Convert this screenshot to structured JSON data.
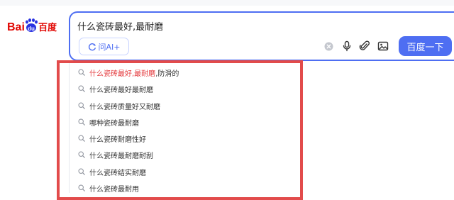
{
  "logo": {
    "text_left": "Bai",
    "text_paw": "du",
    "text_right": "百度"
  },
  "search": {
    "query": "什么瓷砖最好,最耐磨",
    "ai_button_label": "问AI+",
    "submit_label": "百度一下"
  },
  "suggestions": [
    {
      "highlight": "什么瓷砖最好,最耐磨",
      "rest": ",防滑的"
    },
    {
      "highlight": "",
      "rest": "什么瓷砖最好最耐磨"
    },
    {
      "highlight": "",
      "rest": "什么瓷砖质量好又耐磨"
    },
    {
      "highlight": "",
      "rest": "哪种瓷砖最耐磨"
    },
    {
      "highlight": "",
      "rest": "什么瓷砖耐磨性好"
    },
    {
      "highlight": "",
      "rest": "什么瓷砖最耐磨耐刮"
    },
    {
      "highlight": "",
      "rest": "什么瓷砖结实耐磨"
    },
    {
      "highlight": "",
      "rest": "什么瓷砖最耐用"
    }
  ],
  "colors": {
    "brand_blue": "#4e6ef2",
    "logo_red": "#e10602",
    "highlight_red": "#e4393c",
    "annotation_frame": "#e24b4b"
  },
  "icons": [
    "search-icon",
    "voice-icon",
    "clip-icon",
    "image-icon",
    "clear-icon",
    "ai-spark-icon"
  ]
}
